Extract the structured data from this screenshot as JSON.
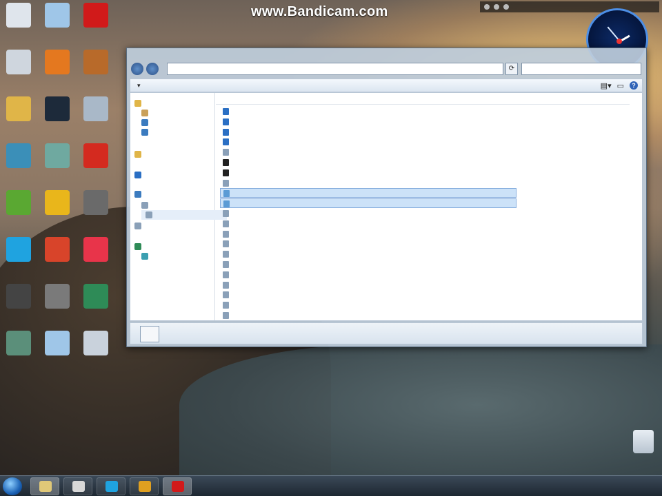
{
  "watermark": "www.Bandicam.com",
  "desktop": {
    "icons": [
      {
        "label": "",
        "color": "#dfe5ec"
      },
      {
        "label": "",
        "color": "#9fc6e8"
      },
      {
        "label": "",
        "color": "#d11a1a"
      },
      {
        "label": "",
        "color": "#cfd6de"
      },
      {
        "label": "",
        "color": "#e4781f"
      },
      {
        "label": "",
        "color": "#b86a2a"
      },
      {
        "label": "",
        "color": "#e0b548"
      },
      {
        "label": "",
        "color": "#1d2a3a"
      },
      {
        "label": "",
        "color": "#a9b8c8"
      },
      {
        "label": "",
        "color": "#3b8fb8"
      },
      {
        "label": "",
        "color": "#6fa9a0"
      },
      {
        "label": "",
        "color": "#d42a1f"
      },
      {
        "label": "",
        "color": "#5aa832"
      },
      {
        "label": "",
        "color": "#e9b61b"
      },
      {
        "label": "",
        "color": "#6a6a6a"
      },
      {
        "label": "",
        "color": "#1fa3e0"
      },
      {
        "label": "",
        "color": "#d8442a"
      },
      {
        "label": "",
        "color": "#e8344a"
      },
      {
        "label": "",
        "color": "#444"
      },
      {
        "label": "",
        "color": "#7a7a7a"
      },
      {
        "label": "",
        "color": "#2e8b57"
      },
      {
        "label": "",
        "color": "#5b8f7a"
      },
      {
        "label": "",
        "color": "#9fc6e8"
      },
      {
        "label": "",
        "color": "#c9d2dc"
      }
    ]
  },
  "explorer": {
    "address": "",
    "search_placeholder": "",
    "commands": {
      "organize": "",
      "open": "",
      "print": "",
      "burn": "",
      "new_folder": ""
    },
    "columns": {
      "name": "",
      "date": "",
      "type": "",
      "size": ""
    },
    "nav": [
      {
        "label": ""
      },
      {
        "label": ""
      },
      {
        "label": ""
      },
      {
        "label": ""
      },
      {
        "label": ""
      },
      {
        "label": ""
      },
      {
        "label": ""
      },
      {
        "label": ""
      },
      {
        "label": ""
      },
      {
        "label": ""
      },
      {
        "label": ""
      },
      {
        "label": ""
      }
    ],
    "files": [
      {
        "name": "",
        "date": "",
        "type": "",
        "size": ""
      },
      {
        "name": "",
        "date": "",
        "type": "",
        "size": ""
      },
      {
        "name": "",
        "date": "",
        "type": "",
        "size": ""
      },
      {
        "name": "",
        "date": "",
        "type": "",
        "size": ""
      },
      {
        "name": "",
        "date": "",
        "type": "",
        "size": ""
      },
      {
        "name": "",
        "date": "",
        "type": "",
        "size": ""
      },
      {
        "name": "",
        "date": "",
        "type": "",
        "size": ""
      },
      {
        "name": "",
        "date": "",
        "type": "",
        "size": ""
      },
      {
        "name": "",
        "date": "",
        "type": "",
        "size": ""
      },
      {
        "name": "",
        "date": "",
        "type": "",
        "size": ""
      },
      {
        "name": "",
        "date": "",
        "type": "",
        "size": ""
      },
      {
        "name": "",
        "date": "",
        "type": "",
        "size": ""
      },
      {
        "name": "",
        "date": "",
        "type": "",
        "size": ""
      },
      {
        "name": "",
        "date": "",
        "type": "",
        "size": ""
      },
      {
        "name": "",
        "date": "",
        "type": "",
        "size": ""
      },
      {
        "name": "",
        "date": "",
        "type": "",
        "size": ""
      },
      {
        "name": "",
        "date": "",
        "type": "",
        "size": ""
      },
      {
        "name": "",
        "date": "",
        "type": "",
        "size": ""
      },
      {
        "name": "",
        "date": "",
        "type": "",
        "size": ""
      },
      {
        "name": "",
        "date": "",
        "type": "",
        "size": ""
      },
      {
        "name": "",
        "date": "",
        "type": "",
        "size": ""
      }
    ],
    "details": {
      "line1": "",
      "line2": "",
      "line3": ""
    }
  },
  "taskbar": {
    "apps": [
      {
        "name": "file-explorer",
        "color": "#e0c878",
        "active": true
      },
      {
        "name": "media",
        "color": "#d8d8d8",
        "active": false
      },
      {
        "name": "skype",
        "color": "#1fa3e0",
        "active": false
      },
      {
        "name": "chrome",
        "color": "#e0a020",
        "active": false
      },
      {
        "name": "bandicam",
        "color": "#d11a1a",
        "active": true
      }
    ],
    "clock_time": "",
    "clock_date": ""
  }
}
